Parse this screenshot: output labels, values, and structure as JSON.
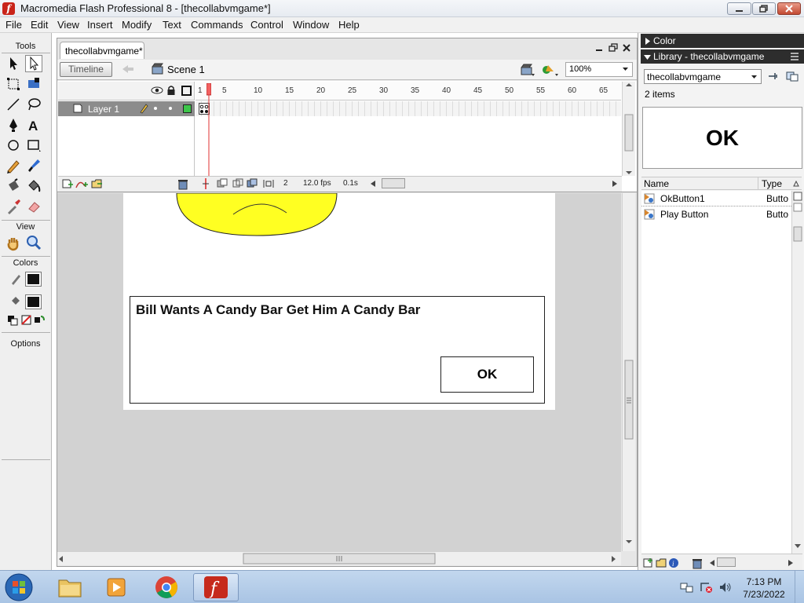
{
  "window": {
    "title": "Macromedia Flash Professional 8 - [thecollabvmgame*]"
  },
  "menu": [
    "File",
    "Edit",
    "View",
    "Insert",
    "Modify",
    "Text",
    "Commands",
    "Control",
    "Window",
    "Help"
  ],
  "tools_panel": {
    "tools_label": "Tools",
    "view_label": "View",
    "colors_label": "Colors",
    "options_label": "Options"
  },
  "document": {
    "tab_title": "thecollabvmgame*",
    "timeline_button": "Timeline",
    "scene_label": "Scene 1",
    "zoom": "100%"
  },
  "timeline": {
    "ruler_numbers": [
      "1",
      "5",
      "10",
      "15",
      "20",
      "25",
      "30",
      "35",
      "40",
      "45",
      "50",
      "55",
      "60",
      "65"
    ],
    "layer_name": "Layer 1",
    "current_frame": "2",
    "frame_rate": "12.0 fps",
    "elapsed": "0.1s"
  },
  "stage": {
    "dialog_text": "Bill Wants A Candy Bar Get Him A Candy Bar",
    "button_label": "OK",
    "face_color": "#ffff22"
  },
  "right_panels": {
    "color_header": "Color",
    "library_header": "Library - thecollabvmgame",
    "library_select": "thecollabvmgame",
    "item_count": "2 items",
    "preview_label": "OK",
    "columns": {
      "name": "Name",
      "type": "Type"
    },
    "items": [
      {
        "name": "OkButton1",
        "type": "Butto"
      },
      {
        "name": "Play Button",
        "type": "Butto"
      }
    ]
  },
  "taskbar": {
    "time": "7:13 PM",
    "date": "7/23/2022"
  }
}
